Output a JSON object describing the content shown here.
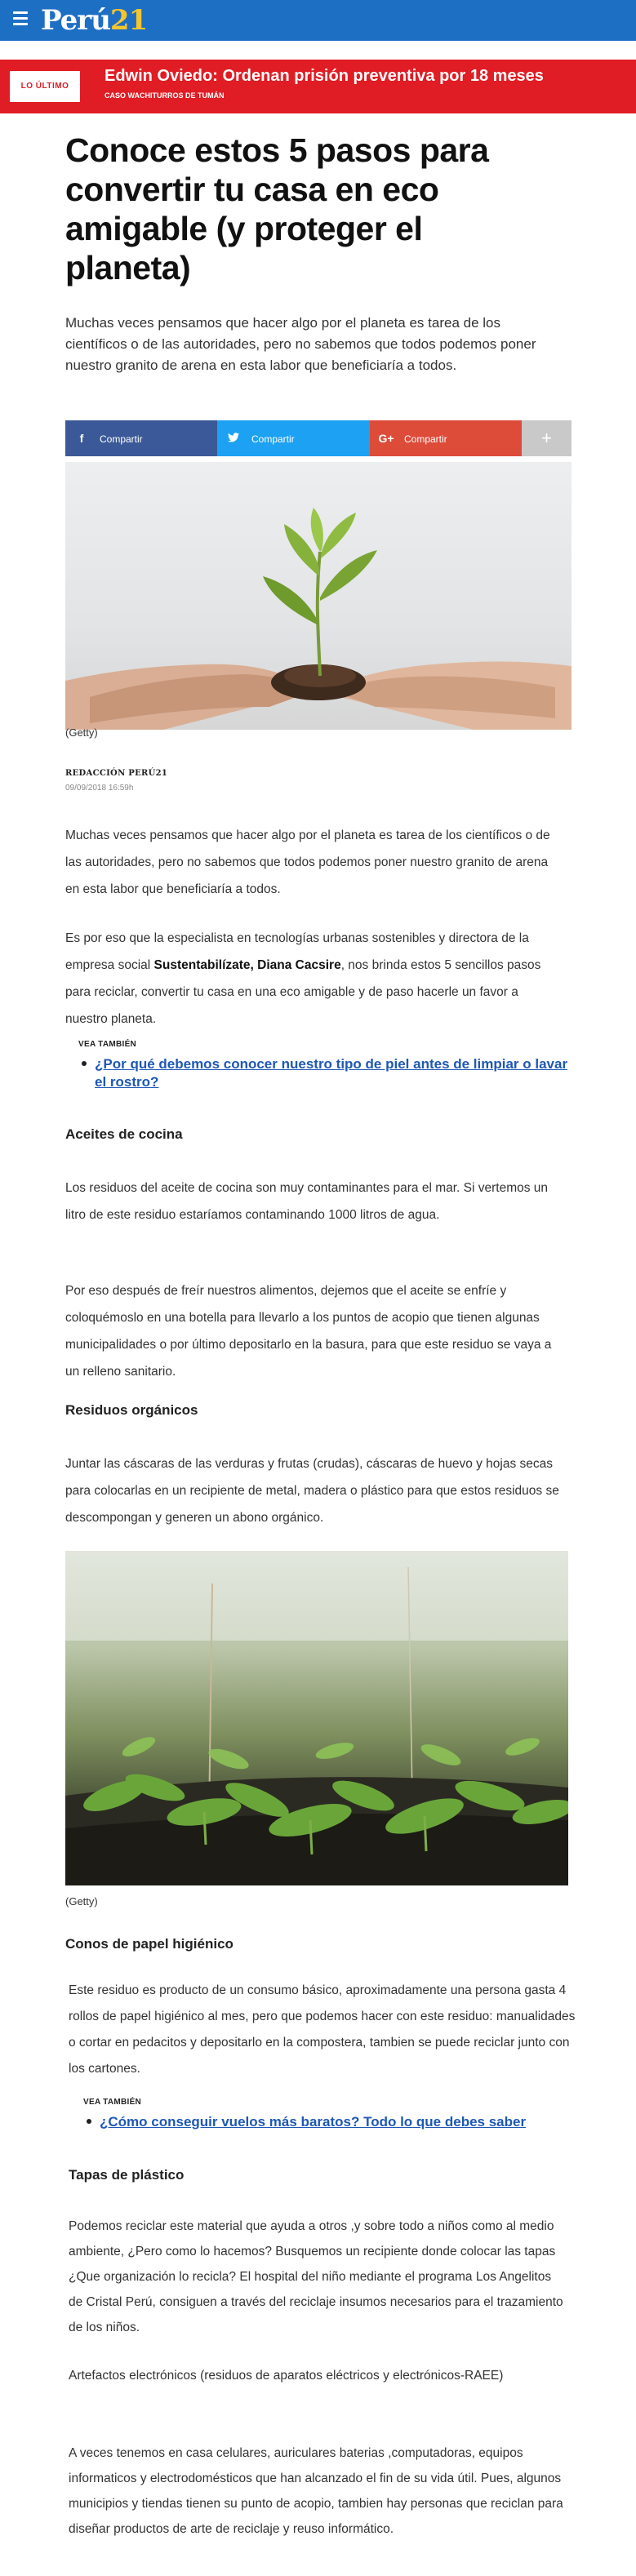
{
  "header": {
    "logo_word": "Perú",
    "logo_num": "21",
    "brand_color": "#1d6fc4"
  },
  "breaking": {
    "tag": "LO ÚLTIMO",
    "title": "Edwin Oviedo: Ordenan prisión preventiva por 18 meses",
    "subtitle": "CASO WACHITURROS DE TUMÁN"
  },
  "article": {
    "title": "Conoce estos 5 pasos para convertir tu casa en eco amigable (y proteger el planeta)",
    "lead": "Muchas veces pensamos que hacer algo por el planeta es tarea de los científicos o de las autoridades, pero no sabemos que todos podemos poner nuestro granito de arena en esta labor que beneficiaría a todos.",
    "share": {
      "facebook": "Compartir",
      "twitter": "Compartir",
      "google": "Compartir",
      "more": "+"
    },
    "image1_caption": "(Getty)",
    "byline": "REDACCIÓN PERÚ21",
    "date": "09/09/2018 16:59h",
    "p1": "Muchas veces pensamos que hacer algo por el planeta es tarea de los científicos o de las autoridades, pero no sabemos que todos podemos poner nuestro granito de arena en esta labor que beneficiaría a todos.",
    "p2_a": "Es por eso que la especialista en tecnologías urbanas sostenibles y directora de la empresa social ",
    "p2_bold": "Sustentabilízate, Diana Cacsire",
    "p2_b": ", nos brinda estos 5 sencillos pasos para reciclar, convertir tu casa en una eco amigable y de paso hacerle un favor a nuestro planeta.",
    "related1": {
      "label": "VEA TAMBIÉN",
      "link": "¿Por qué debemos conocer nuestro tipo de piel antes de limpiar o lavar el rostro?"
    },
    "h1": "Aceites de cocina",
    "p3": "Los residuos del aceite de cocina son muy contaminantes para el mar. Si vertemos un litro de este residuo estaríamos contaminando 1000 litros de agua.",
    "p4": "Por eso después de freír nuestros alimentos, dejemos que el aceite se enfríe y coloquémoslo en una botella para llevarlo a los puntos de acopio que tienen algunas municipalidades o por último depositarlo en la basura, para que este residuo se vaya a un relleno sanitario.",
    "h2": "Residuos orgánicos",
    "p5": "Juntar las cáscaras de las verduras y frutas (crudas), cáscaras de huevo y hojas secas para colocarlas en un recipiente de metal, madera o plástico para que estos residuos se descompongan y generen un abono orgánico.",
    "image2_caption": "(Getty)",
    "h3": "Conos de papel higiénico",
    "p6": "Este residuo es producto de un consumo básico, aproximadamente una persona gasta 4 rollos de papel higiénico al mes, pero que podemos hacer con este residuo: manualidades o cortar en pedacitos y depositarlo en la compostera, tambien se puede reciclar junto con los cartones.",
    "related2": {
      "label": "VEA TAMBIÉN",
      "link": "¿Cómo conseguir vuelos más baratos? Todo lo que debes saber"
    },
    "h4": "Tapas de plástico",
    "p7": "Podemos reciclar este material que ayuda a otros ,y sobre todo a niños como al medio ambiente, ¿Pero como lo hacemos? Busquemos un recipiente donde colocar las tapas ¿Que organización lo recicla? El hospital del niño mediante el programa Los Angelitos de Cristal Perú, consiguen a través del reciclaje insumos necesarios para el trazamiento de los niños.",
    "p8": "Artefactos electrónicos (residuos de aparatos eléctricos y electrónicos-RAEE)",
    "p9": "A veces tenemos en casa celulares, auriculares baterias ,computadoras, equipos informaticos y electrodomésticos que han alcanzado el fin de su vida útil. Pues, algunos municipios y tiendas tienen su punto de acopio, tambien hay personas que reciclan para diseñar productos de arte de reciclaje y reuso informático."
  }
}
